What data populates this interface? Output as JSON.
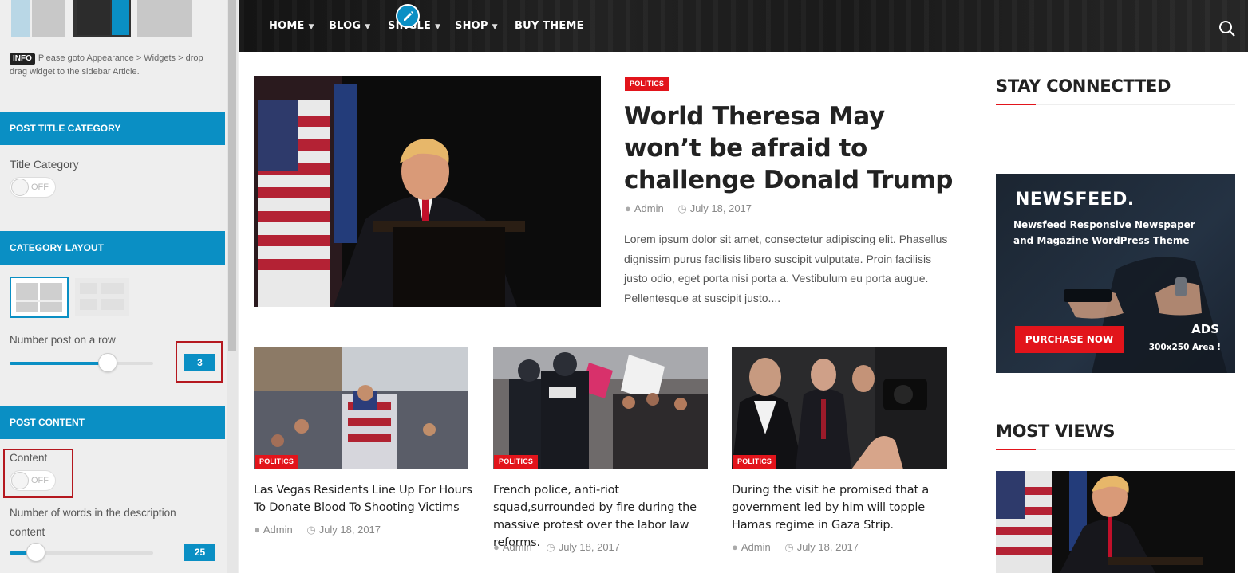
{
  "sidebar": {
    "info_badge": "INFO",
    "info_text": "Please goto Appearance > Widgets > drop drag widget to the sidebar Article.",
    "post_title_category": {
      "heading": "POST TITLE CATEGORY",
      "title_category_label": "Title Category",
      "toggle_text": "OFF",
      "toggle_on": false
    },
    "category_layout": {
      "heading": "CATEGORY LAYOUT",
      "number_post_label": "Number post on a row",
      "number_post_value": "3",
      "number_post_fraction": 0.68
    },
    "post_content": {
      "heading": "POST CONTENT",
      "content_label": "Content",
      "toggle_text": "OFF",
      "toggle_on": false,
      "words_label": "Number of words in the description content",
      "words_value": "25",
      "words_fraction": 0.18
    }
  },
  "nav": {
    "items": [
      {
        "label": "HOME",
        "dropdown": true
      },
      {
        "label": "BLOG",
        "dropdown": true
      },
      {
        "label": "SINGLE",
        "dropdown": true
      },
      {
        "label": "SHOP",
        "dropdown": true
      },
      {
        "label": "BUY THEME",
        "dropdown": false
      }
    ],
    "search_icon": "search-icon",
    "edit_icon": "pencil-icon"
  },
  "featured": {
    "category": "POLITICS",
    "title": "World Theresa May won’t be afraid to challenge Donald Trump",
    "author": "Admin",
    "date": "July 18, 2017",
    "excerpt": "Lorem ipsum dolor sit amet, consectetur adipiscing elit. Phasellus dignissim purus facilisis libero suscipit vulputate. Proin facilisis justo odio, eget porta nisi porta a. Vestibulum eu porta augue. Pellentesque at suscipit justo...."
  },
  "cards": [
    {
      "category": "POLITICS",
      "title": "Las Vegas Residents Line Up For Hours To Donate Blood To Shooting Victims",
      "author": "Admin",
      "date": "July 18, 2017"
    },
    {
      "category": "POLITICS",
      "title": "French police, anti-riot squad,surrounded by fire during the massive protest over the labor law reforms.",
      "author": "Admin",
      "date": "July 18, 2017"
    },
    {
      "category": "POLITICS",
      "title": "During the visit he promised that a government led by him will topple Hamas regime in Gaza Strip.",
      "author": "Admin",
      "date": "July 18, 2017"
    }
  ],
  "widgets": {
    "stay_connected": "STAY CONNECTTED",
    "most_views": "MOST VIEWS"
  },
  "ad": {
    "brand": "NEWSFEED.",
    "description": "Newsfeed Responsive Newspaper and Magazine WordPress Theme",
    "cta": "PURCHASE NOW",
    "ads_label": "ADS",
    "size_label": "300x250 Area !"
  },
  "colors": {
    "accent_blue": "#0a8fc4",
    "accent_red": "#e2141b",
    "nav_bg": "#1c1c1c"
  }
}
